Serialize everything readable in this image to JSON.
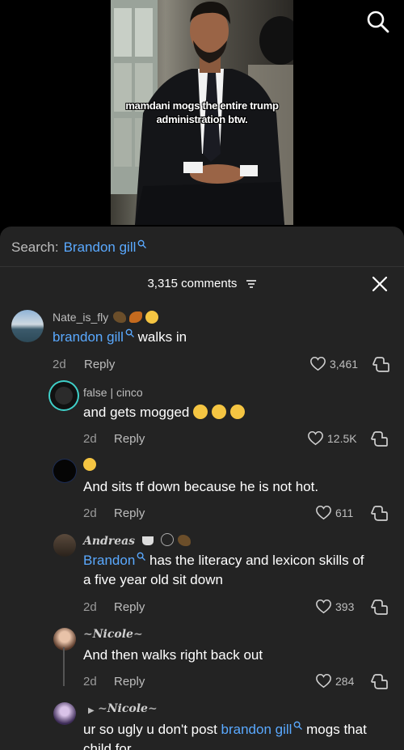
{
  "video": {
    "caption_line1": "mamdani mogs the entire trump",
    "caption_line2": "administration btw."
  },
  "search": {
    "label": "Search:",
    "term": "Brandon gill"
  },
  "comments_header": {
    "count": "3,315 comments"
  },
  "comments": [
    {
      "user": "Nate_is_fly",
      "link": "brandon gill",
      "text": " walks in",
      "age": "2d",
      "reply": "Reply",
      "likes": "3,461"
    },
    {
      "user": "false | cinco",
      "text": "and gets mogged",
      "age": "2d",
      "reply": "Reply",
      "likes": "12.5K"
    },
    {
      "user": "",
      "text": "And sits tf down because he is not hot.",
      "age": "2d",
      "reply": "Reply",
      "likes": "611"
    },
    {
      "user": "Andreas",
      "link": "Brandon",
      "text_line1": " has the literacy and lexicon skills of",
      "text_line2": "a five year old sit down",
      "age": "2d",
      "reply": "Reply",
      "likes": "393"
    },
    {
      "user": "Nicole",
      "text": "And then walks right back out",
      "age": "2d",
      "reply": "Reply",
      "likes": "284"
    },
    {
      "user": "Nicole",
      "text_pre": "ur so ugly u don't post ",
      "link": "brandon gill",
      "text_post": " mogs that",
      "text_line2": "child for"
    }
  ],
  "colors": {
    "link": "#5aa9ff",
    "panel_bg": "#232323"
  }
}
